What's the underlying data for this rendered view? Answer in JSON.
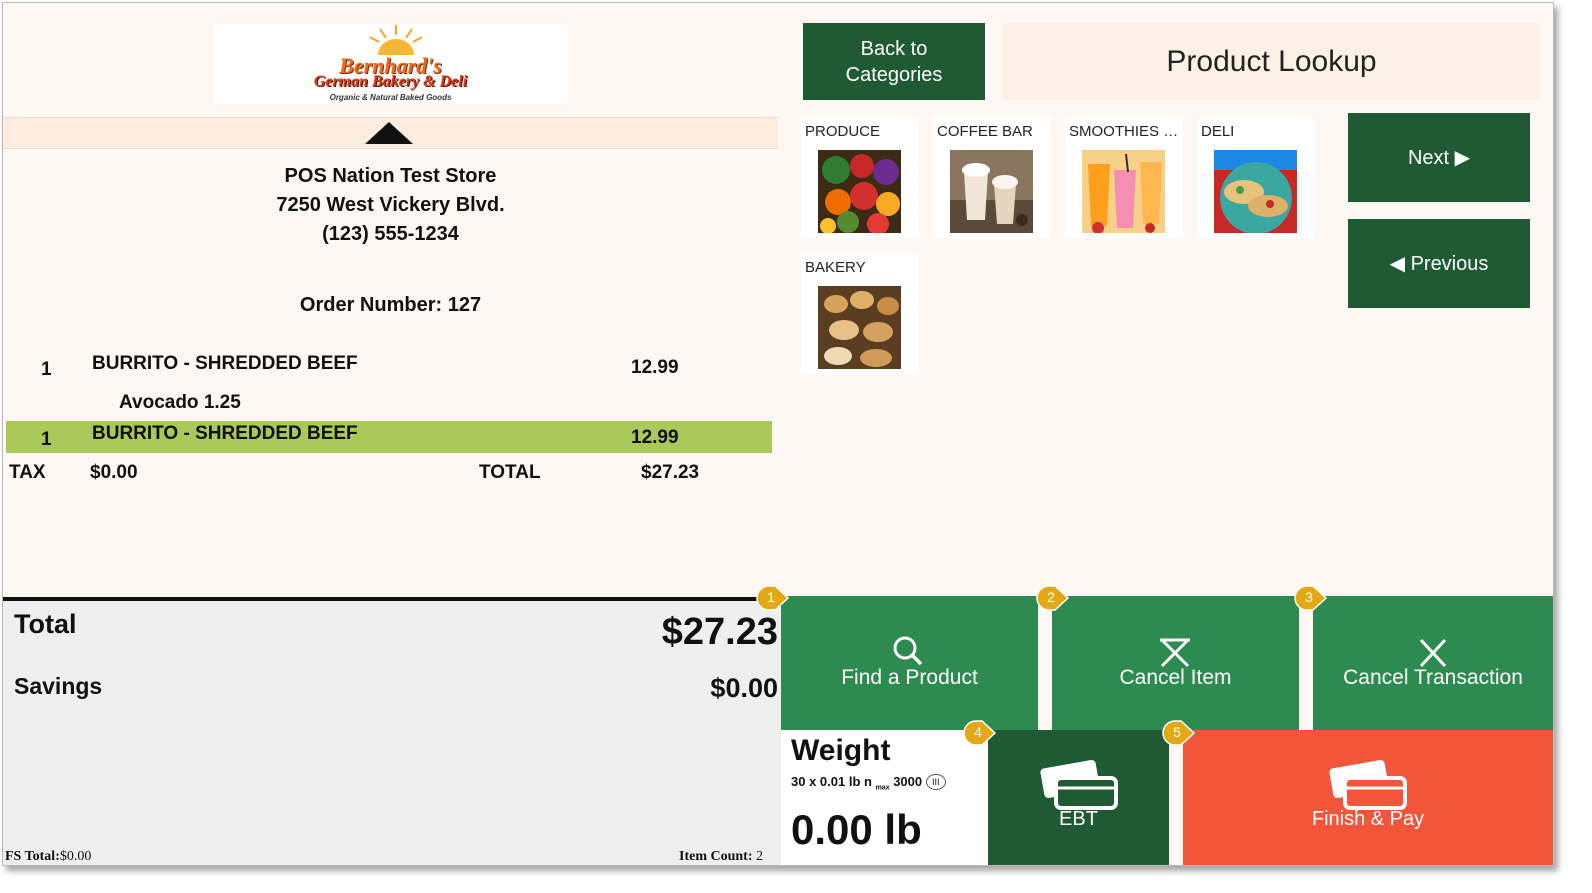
{
  "logo": {
    "line1": "Bernhard's",
    "line2": "German Bakery & Deli",
    "line3": "Organic & Natural Baked Goods"
  },
  "receipt": {
    "store_name": "POS Nation Test Store",
    "address": "7250 West Vickery Blvd.",
    "phone": "(123) 555-1234",
    "order_number": "Order Number: 127",
    "items": [
      {
        "qty": "1",
        "name": "BURRITO - SHREDDED BEEF",
        "price": "12.99",
        "modifier": "Avocado 1.25"
      },
      {
        "qty": "1",
        "name": "BURRITO - SHREDDED BEEF",
        "price": "12.99",
        "selected": true
      }
    ],
    "tax_label": "TAX",
    "tax_value": "$0.00",
    "total_label": "TOTAL",
    "total_value": "$27.23"
  },
  "summary": {
    "total_label": "Total",
    "total_value": "$27.23",
    "savings_label": "Savings",
    "savings_value": "$0.00",
    "fs_total_label": "FS Total:",
    "fs_total_value": "$0.00",
    "item_count_label": "Item Count:",
    "item_count_value": "2"
  },
  "header": {
    "back_label_line1": "Back to",
    "back_label_line2": "Categories",
    "title": "Product Lookup"
  },
  "categories": [
    {
      "label": "PRODUCE",
      "icon": "produce-image"
    },
    {
      "label": "COFFEE BAR",
      "icon": "coffee-image"
    },
    {
      "label": "SMOOTHIES & ...",
      "icon": "smoothies-image"
    },
    {
      "label": "DELI",
      "icon": "deli-image"
    },
    {
      "label": "BAKERY",
      "icon": "bakery-image"
    }
  ],
  "nav": {
    "next_label": "Next ▶",
    "previous_label": "◀ Previous"
  },
  "actions": {
    "find_product": "Find a Product",
    "cancel_item": "Cancel Item",
    "cancel_transaction": "Cancel Transaction",
    "ebt": "EBT",
    "finish_pay": "Finish & Pay"
  },
  "weight": {
    "title": "Weight",
    "spec_prefix": "30 x 0.01 lb n",
    "spec_sub": "max",
    "spec_suffix": "3000",
    "spec_class": "III",
    "value": "0.00 lb"
  },
  "badges": [
    "1",
    "2",
    "3",
    "4",
    "5"
  ],
  "colors": {
    "dark_green": "#1f5a34",
    "action_green": "#2d8a50",
    "pay_orange": "#f4553a",
    "highlight_row": "#a9c95a",
    "badge_gold": "#e3a814"
  }
}
